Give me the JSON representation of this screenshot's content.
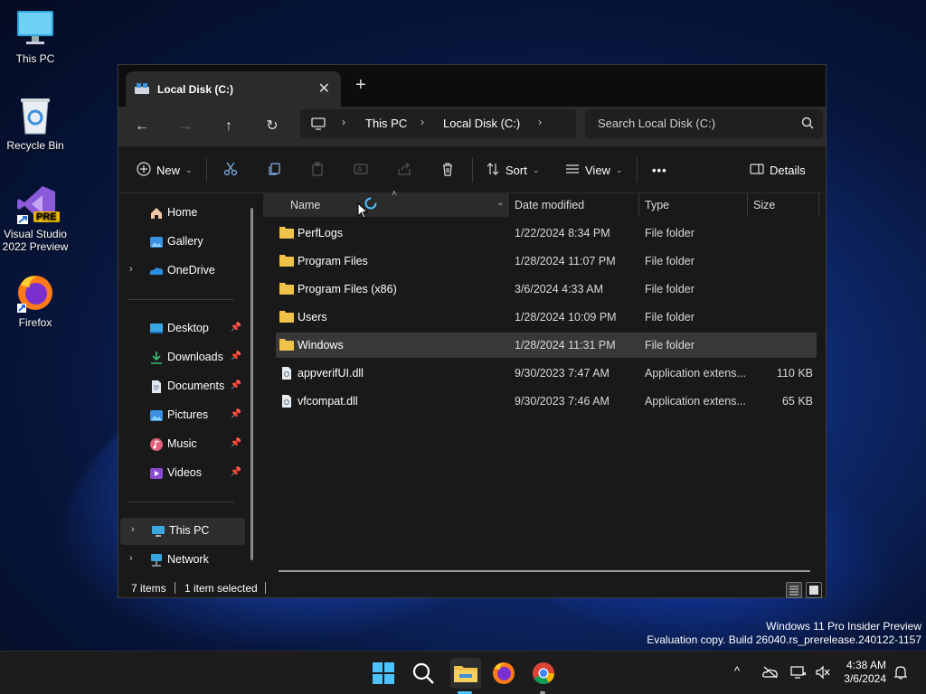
{
  "desktop": {
    "icons": [
      {
        "label": "This PC",
        "icon": "monitor-icon"
      },
      {
        "label": "Recycle Bin",
        "icon": "recycle-bin-icon"
      },
      {
        "label_line1": "Visual Studio",
        "label_line2": "2022 Preview",
        "badge": "PRE",
        "icon": "visual-studio-icon"
      },
      {
        "label": "Firefox",
        "icon": "firefox-icon"
      }
    ]
  },
  "window": {
    "tab_title": "Local Disk (C:)",
    "close_glyph": "✕",
    "new_tab_glyph": "+",
    "nav": {
      "back": "←",
      "forward": "→",
      "up": "↑",
      "refresh": "↻"
    },
    "breadcrumb": [
      "This PC",
      "Local Disk (C:)"
    ],
    "search_placeholder": "Search Local Disk (C:)",
    "toolbar": {
      "new_label": "New",
      "sort_label": "Sort",
      "view_label": "View",
      "more_label": "•••",
      "details_label": "Details"
    },
    "sidebar": {
      "top": [
        {
          "label": "Home",
          "icon": "home-icon"
        },
        {
          "label": "Gallery",
          "icon": "gallery-icon"
        },
        {
          "label": "OneDrive",
          "icon": "onedrive-icon",
          "expandable": true
        }
      ],
      "quick": [
        {
          "label": "Desktop",
          "icon": "desktop-icon"
        },
        {
          "label": "Downloads",
          "icon": "downloads-icon"
        },
        {
          "label": "Documents",
          "icon": "documents-icon"
        },
        {
          "label": "Pictures",
          "icon": "pictures-icon"
        },
        {
          "label": "Music",
          "icon": "music-icon"
        },
        {
          "label": "Videos",
          "icon": "videos-icon"
        }
      ],
      "bottom": [
        {
          "label": "This PC",
          "icon": "this-pc-icon",
          "selected": true
        },
        {
          "label": "Network",
          "icon": "network-icon"
        }
      ]
    },
    "columns": {
      "name": "Name",
      "date": "Date modified",
      "type": "Type",
      "size": "Size"
    },
    "files": [
      {
        "name": "PerfLogs",
        "date": "1/22/2024 8:34 PM",
        "type": "File folder",
        "size": "",
        "kind": "folder"
      },
      {
        "name": "Program Files",
        "date": "1/28/2024 11:07 PM",
        "type": "File folder",
        "size": "",
        "kind": "folder"
      },
      {
        "name": "Program Files (x86)",
        "date": "3/6/2024 4:33 AM",
        "type": "File folder",
        "size": "",
        "kind": "folder"
      },
      {
        "name": "Users",
        "date": "1/28/2024 10:09 PM",
        "type": "File folder",
        "size": "",
        "kind": "folder"
      },
      {
        "name": "Windows",
        "date": "1/28/2024 11:31 PM",
        "type": "File folder",
        "size": "",
        "kind": "folder",
        "selected": true
      },
      {
        "name": "appverifUI.dll",
        "date": "9/30/2023 7:47 AM",
        "type": "Application extens...",
        "size": "110 KB",
        "kind": "file"
      },
      {
        "name": "vfcompat.dll",
        "date": "9/30/2023 7:46 AM",
        "type": "Application extens...",
        "size": "65 KB",
        "kind": "file"
      }
    ],
    "status": {
      "items": "7 items",
      "selected": "1 item selected"
    }
  },
  "watermark": {
    "line1": "Windows 11 Pro Insider Preview",
    "line2": "Evaluation copy. Build 26040.rs_prerelease.240122-1157"
  },
  "taskbar": {
    "time": "4:38 AM",
    "date": "3/6/2024",
    "chevron": "^"
  },
  "colors": {
    "folder": "#f0c24a",
    "accent": "#4cc2ff",
    "window_bg": "#191919"
  }
}
